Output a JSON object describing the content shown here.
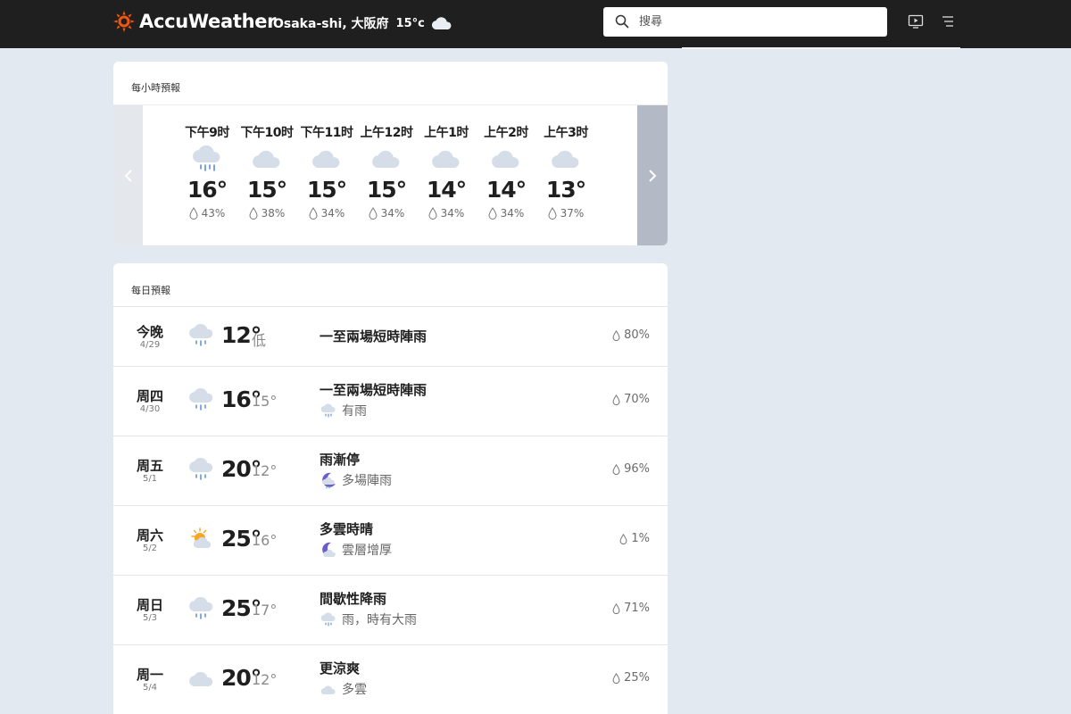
{
  "header": {
    "brand": "AccuWeather",
    "location": "Osaka-shi, 大阪府",
    "current_temp": "15°c",
    "current_icon": "cloudy-icon",
    "search": {
      "placeholder": "搜尋",
      "value": ""
    },
    "brand_color": "#f05514"
  },
  "hourly": {
    "title": "每小時預報",
    "items": [
      {
        "time": "下午9时",
        "icon": "rain-icon",
        "temp": "16°",
        "precip": "43%"
      },
      {
        "time": "下午10时",
        "icon": "cloudy-icon",
        "temp": "15°",
        "precip": "38%"
      },
      {
        "time": "下午11时",
        "icon": "cloudy-icon",
        "temp": "15°",
        "precip": "34%"
      },
      {
        "time": "上午12时",
        "icon": "cloudy-icon",
        "temp": "15°",
        "precip": "34%"
      },
      {
        "time": "上午1时",
        "icon": "cloudy-icon",
        "temp": "14°",
        "precip": "34%"
      },
      {
        "time": "上午2时",
        "icon": "cloudy-icon",
        "temp": "14°",
        "precip": "34%"
      },
      {
        "time": "上午3时",
        "icon": "cloudy-icon",
        "temp": "13°",
        "precip": "37%"
      }
    ]
  },
  "daily": {
    "title": "每日預報",
    "items": [
      {
        "day": "今晚",
        "date": "4/29",
        "icon": "rain-icon",
        "high": "12°",
        "low": "低",
        "phrase": "一至兩場短時陣雨",
        "night_icon": "",
        "night_phrase": "",
        "precip": "80%"
      },
      {
        "day": "周四",
        "date": "4/30",
        "icon": "rain-icon",
        "high": "16°",
        "low": "15°",
        "phrase": "一至兩場短時陣雨",
        "night_icon": "rain-icon",
        "night_phrase": "有雨",
        "precip": "70%"
      },
      {
        "day": "周五",
        "date": "5/1",
        "icon": "rain-icon",
        "high": "20°",
        "low": "12°",
        "phrase": "雨漸停",
        "night_icon": "night-showers-icon",
        "night_phrase": "多場陣雨",
        "precip": "96%"
      },
      {
        "day": "周六",
        "date": "5/2",
        "icon": "partly-sunny-icon",
        "high": "25°",
        "low": "16°",
        "phrase": "多雲時晴",
        "night_icon": "night-cloudy-icon",
        "night_phrase": "雲層增厚",
        "precip": "1%"
      },
      {
        "day": "周日",
        "date": "5/3",
        "icon": "rain-icon",
        "high": "25°",
        "low": "17°",
        "phrase": "間歇性降雨",
        "night_icon": "rain-icon",
        "night_phrase": "雨，時有大雨",
        "precip": "71%"
      },
      {
        "day": "周一",
        "date": "5/4",
        "icon": "cloudy-icon",
        "high": "20°",
        "low": "12°",
        "phrase": "更涼爽",
        "night_icon": "cloudy-icon",
        "night_phrase": "多雲",
        "precip": "25%"
      }
    ]
  }
}
